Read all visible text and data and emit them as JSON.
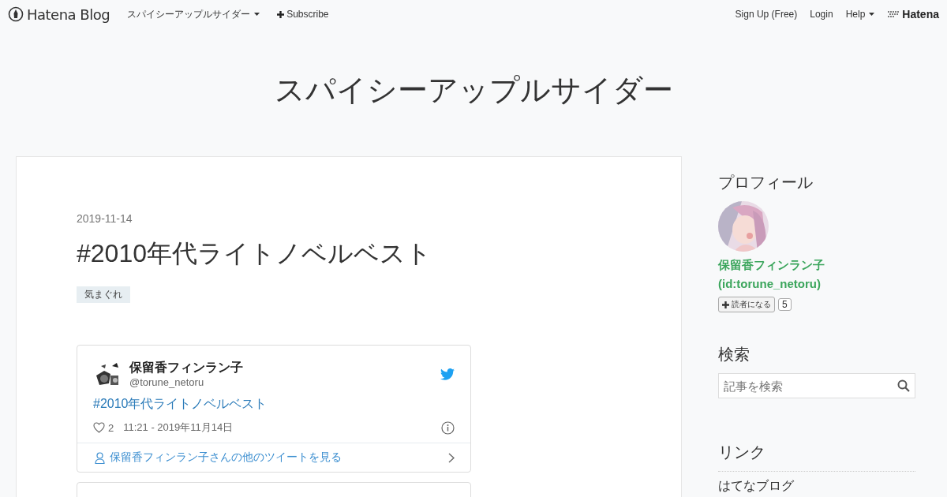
{
  "top_bar": {
    "logo": "Hatena Blog",
    "blog_menu": "スパイシーアップルサイダー",
    "subscribe": "Subscribe",
    "right_links": [
      "Sign Up (Free)",
      "Login"
    ],
    "help": "Help",
    "brand": "Hatena"
  },
  "blog_title": "スパイシーアップルサイダー",
  "entry": {
    "date": "2019-11-14",
    "title": "#2010年代ライトノベルベスト",
    "categories": [
      "気まぐれ"
    ],
    "tweet": {
      "author": "保留香フィンラン子",
      "handle": "@torune_netoru",
      "text": "#2010年代ライトノベルベスト",
      "likes": "2",
      "time": "11:21 - 2019年11月14日",
      "more": "保留香フィンラン子さんの他のツイートを見る"
    }
  },
  "sidebar": {
    "profile": {
      "heading": "プロフィール",
      "name": "保留香フィンラン子",
      "id": "(id:torune_netoru)",
      "subscribe": "読者になる",
      "count": "5"
    },
    "search": {
      "heading": "検索",
      "placeholder": "記事を検索"
    },
    "links": {
      "heading": "リンク",
      "items": [
        "はてなブログ"
      ]
    }
  }
}
